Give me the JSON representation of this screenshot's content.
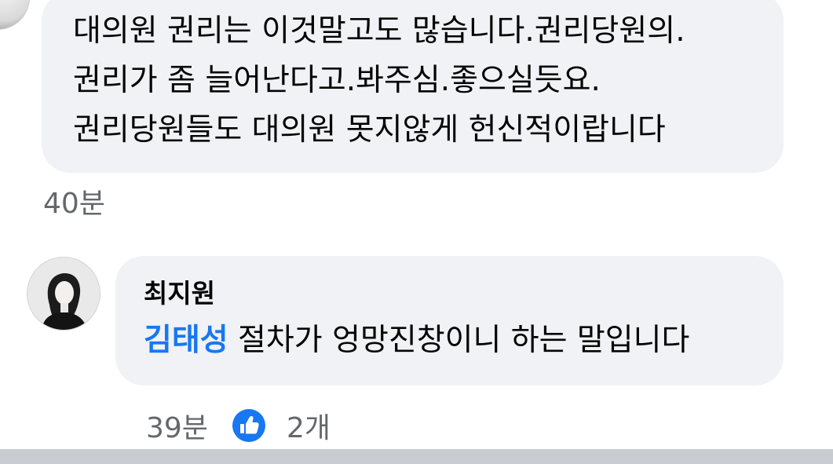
{
  "comment_prev": {
    "lines": [
      "대의원 권리는 이것말고도 많습니다.권리당원의.",
      "권리가 좀 늘어난다고.봐주심.좋으실듯요.",
      "권리당원들도 대의원 못지않게 헌신적이랍니다"
    ],
    "time": "40분"
  },
  "comment": {
    "author": "최지원",
    "mention": "김태성",
    "text": " 절차가 엉망진창이니 하는 말입니다",
    "time": "39분",
    "reaction_icon": "like-thumb-icon",
    "reaction_count": "2개"
  },
  "colors": {
    "bubble": "#f0f2f5",
    "mention": "#1877f2",
    "meta": "#65676b",
    "like_blue": "#1877f2"
  }
}
